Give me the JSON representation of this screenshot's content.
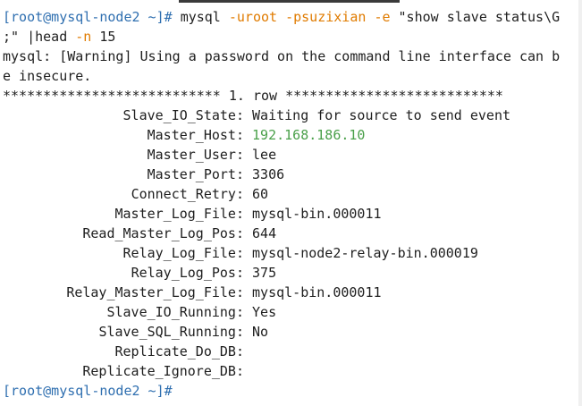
{
  "terminal": {
    "cmd_line1": {
      "prompt_open": "[",
      "prompt_user_host": "root@mysql-node2",
      "prompt_rest": " ~]# ",
      "cmd": "mysql ",
      "opt1": "-uroot",
      "sp1": " ",
      "opt2": "-psuzixian",
      "sp2": " ",
      "opt3": "-e",
      "tail": " \"show slave status\\G"
    },
    "cmd_line2": {
      "text": ";\" |head ",
      "opt": "-n",
      "tail": " 15"
    },
    "warn_line1": {
      "pre": "mysql: ",
      "tag": "[Warning]",
      "post": " Using a password on the command line interface can b"
    },
    "warn_line2": "e insecure.",
    "row_header": "*************************** 1. row ***************************",
    "rows": [
      {
        "key": "Slave_IO_State:",
        "value": "Waiting for source to send event"
      },
      {
        "key": "Master_Host:",
        "value": "192.168.186.10"
      },
      {
        "key": "Master_User:",
        "value": "lee"
      },
      {
        "key": "Master_Port:",
        "value": "3306"
      },
      {
        "key": "Connect_Retry:",
        "value": "60"
      },
      {
        "key": "Master_Log_File:",
        "value": "mysql-bin.000011"
      },
      {
        "key": "Read_Master_Log_Pos:",
        "value": "644"
      },
      {
        "key": "Relay_Log_File:",
        "value": "mysql-node2-relay-bin.000019"
      },
      {
        "key": "Relay_Log_Pos:",
        "value": "375"
      },
      {
        "key": "Relay_Master_Log_File:",
        "value": "mysql-bin.000011"
      },
      {
        "key": "Slave_IO_Running:",
        "value": "Yes"
      },
      {
        "key": "Slave_SQL_Running:",
        "value": "No"
      },
      {
        "key": "Replicate_Do_DB:",
        "value": ""
      },
      {
        "key": "Replicate_Ignore_DB:",
        "value": ""
      }
    ],
    "final_prompt": {
      "open": "[",
      "user_host": "root@mysql-node2",
      "rest": " ~]#"
    }
  },
  "colors": {
    "prompt": "#2f6fb0",
    "option": "#e07b00",
    "ip": "#4aa04a",
    "text": "#1e1e1e"
  }
}
